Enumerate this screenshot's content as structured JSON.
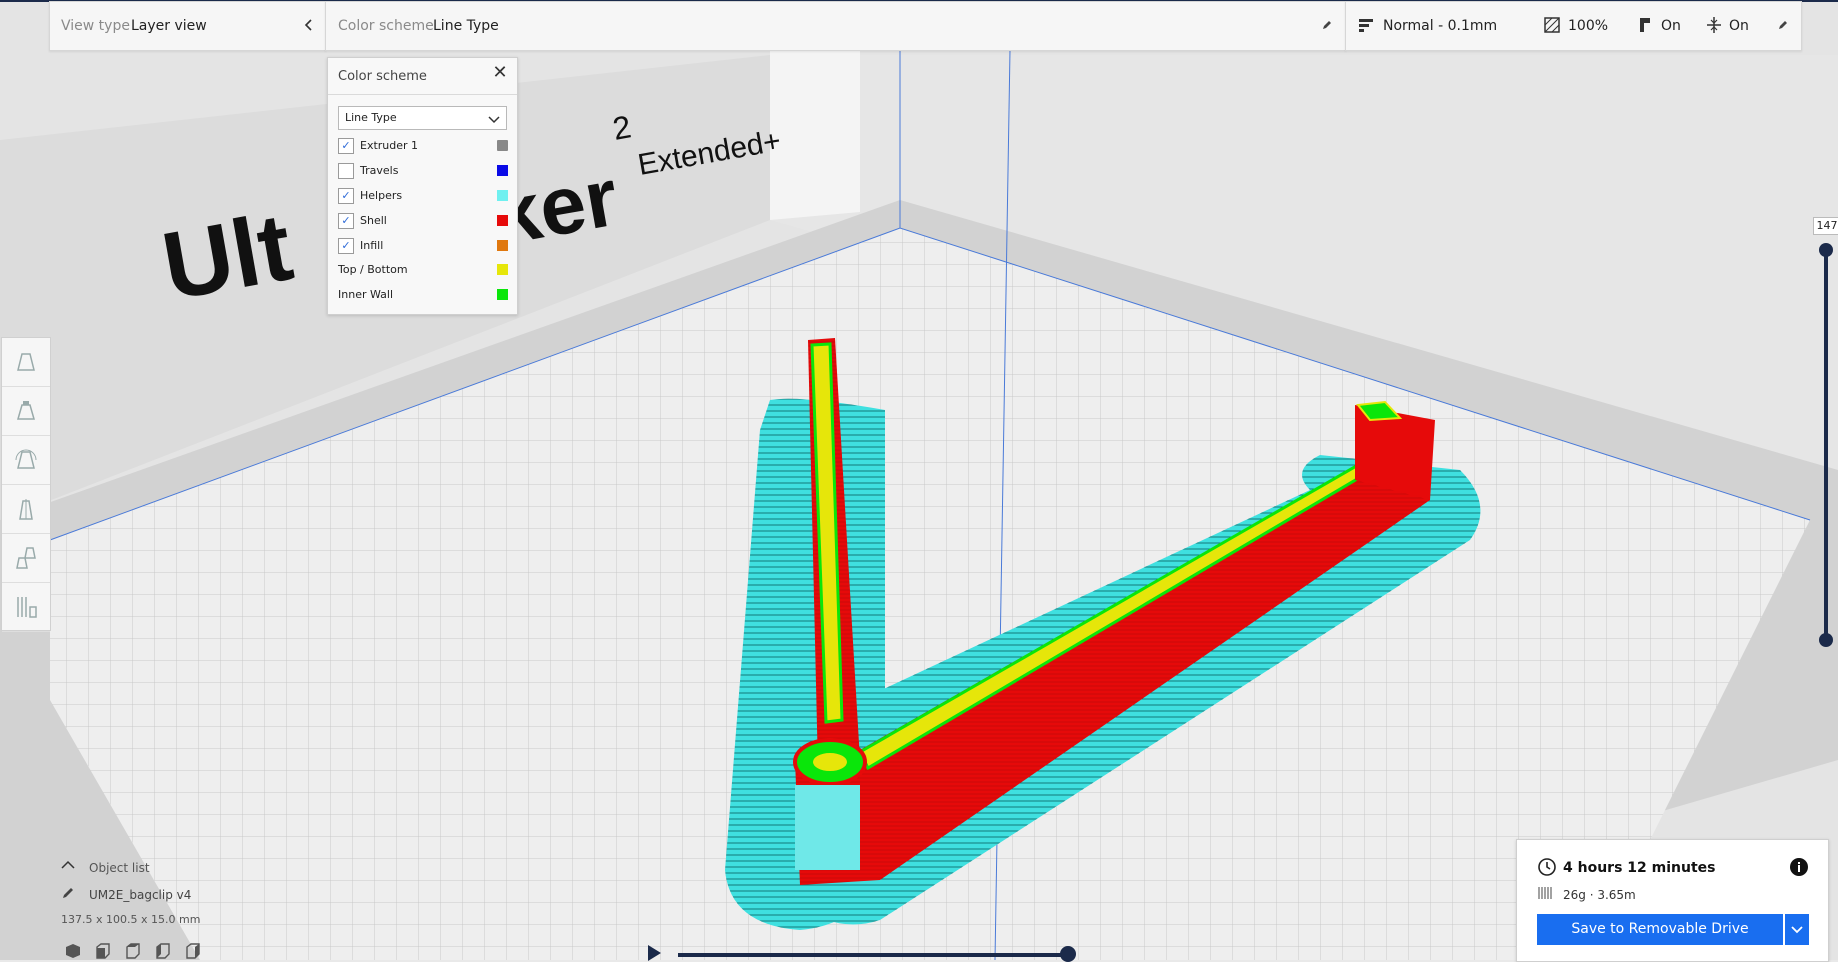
{
  "header": {
    "view_type_label": "View type",
    "view_type_value": "Layer view",
    "color_scheme_label": "Color scheme",
    "color_scheme_value": "Line Type",
    "profile": "Normal - 0.1mm",
    "infill": "100%",
    "support": "On",
    "adhesion": "On"
  },
  "scene": {
    "printer_brand_text_left": "Ult",
    "printer_brand_text_right": "ker",
    "printer_superscript": "2",
    "printer_model": "Extended+"
  },
  "color_panel": {
    "title": "Color scheme",
    "select_value": "Line Type",
    "items": [
      {
        "label": "Extruder 1",
        "checked": true,
        "color": "#888888"
      },
      {
        "label": "Travels",
        "checked": false,
        "color": "#0a0ae6"
      },
      {
        "label": "Helpers",
        "checked": true,
        "color": "#6ff0f0"
      },
      {
        "label": "Shell",
        "checked": true,
        "color": "#e60a0a"
      },
      {
        "label": "Infill",
        "checked": true,
        "color": "#e0780f"
      },
      {
        "label": "Top / Bottom",
        "checked": null,
        "color": "#e6e60a"
      },
      {
        "label": "Inner Wall",
        "checked": null,
        "color": "#0ae60a"
      }
    ]
  },
  "layer_slider": {
    "current_layer": "147"
  },
  "object_list": {
    "header": "Object list",
    "object_name": "UM2E_bagclip v4",
    "dimensions": "137.5 x 100.5 x 15.0 mm"
  },
  "print_info": {
    "time": "4 hours 12 minutes",
    "material": "26g · 3.65m",
    "save_button": "Save to Removable Drive"
  },
  "colors": {
    "accent": "#196ef0",
    "dark": "#1b2a4a",
    "shell": "#e60a0a",
    "helpers": "#3fe0e0",
    "inner_wall": "#0ae60a",
    "top_bottom": "#e6e60a"
  }
}
